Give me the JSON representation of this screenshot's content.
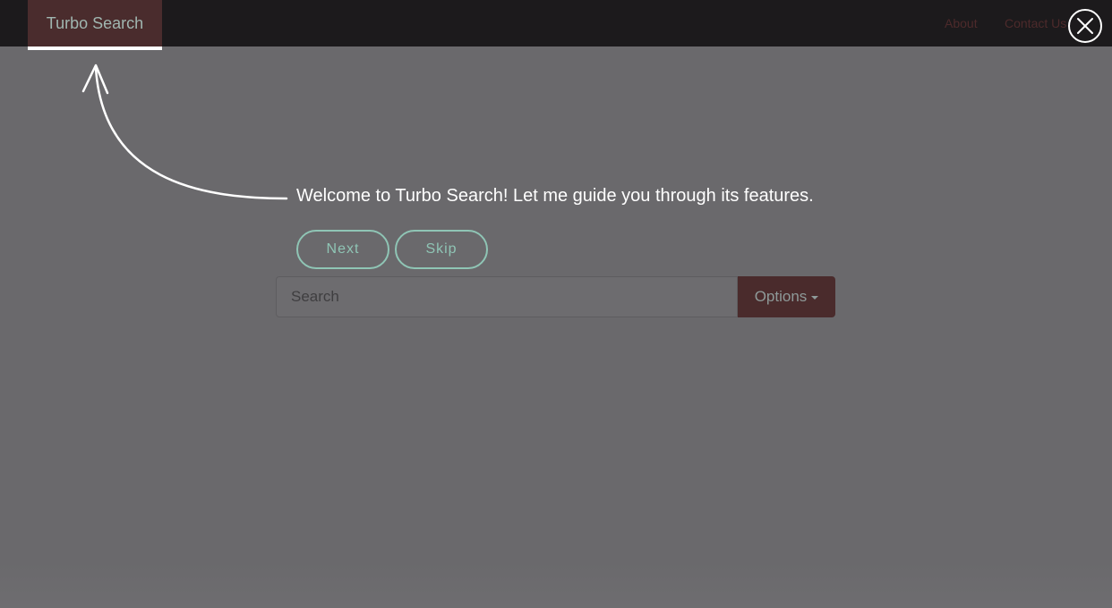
{
  "navbar": {
    "brand": "Turbo Search",
    "links": [
      "About",
      "Contact Us"
    ]
  },
  "search": {
    "placeholder": "Search",
    "options_label": "Options"
  },
  "tour": {
    "message": "Welcome to Turbo Search! Let me guide you through its features.",
    "next_label": "Next",
    "skip_label": "Skip"
  },
  "colors": {
    "overlay": "#6a696c",
    "navbar": "#1c1a1c",
    "brand_bg": "#4a2c2d",
    "tour_accent": "#8fc5b5"
  },
  "icons": {
    "close": "close-icon",
    "caret": "caret-down-icon",
    "pointer": "curved-arrow-icon"
  }
}
